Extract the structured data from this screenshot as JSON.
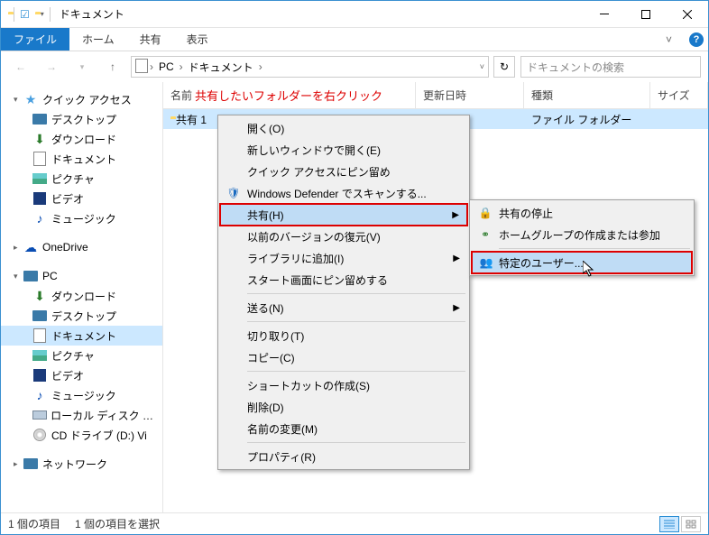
{
  "title": "ドキュメント",
  "ribbon": {
    "file": "ファイル",
    "home": "ホーム",
    "share": "共有",
    "view": "表示"
  },
  "breadcrumb": {
    "pc": "PC",
    "docs": "ドキュメント"
  },
  "search_placeholder": "ドキュメントの検索",
  "annotation": "共有したいフォルダーを右クリック",
  "columns": {
    "name": "名前",
    "date": "更新日時",
    "type": "種類",
    "size": "サイズ"
  },
  "row": {
    "name": "共有 1",
    "type": "ファイル フォルダー"
  },
  "sidebar": {
    "quick": "クイック アクセス",
    "desktop": "デスクトップ",
    "downloads": "ダウンロード",
    "documents": "ドキュメント",
    "pictures": "ピクチャ",
    "videos": "ビデオ",
    "music": "ミュージック",
    "onedrive": "OneDrive",
    "pc": "PC",
    "pc_downloads": "ダウンロード",
    "pc_desktop": "デスクトップ",
    "pc_documents": "ドキュメント",
    "pc_pictures": "ピクチャ",
    "pc_videos": "ビデオ",
    "pc_music": "ミュージック",
    "pc_cdrive": "ローカル ディスク (C:)",
    "pc_ddrive": "CD ドライブ (D:) Vi",
    "network": "ネットワーク"
  },
  "ctx": {
    "open": "開く(O)",
    "open_new": "新しいウィンドウで開く(E)",
    "pin_quick": "クイック アクセスにピン留め",
    "defender": "Windows Defender でスキャンする...",
    "share": "共有(H)",
    "restore": "以前のバージョンの復元(V)",
    "library": "ライブラリに追加(I)",
    "pin_start": "スタート画面にピン留めする",
    "send": "送る(N)",
    "cut": "切り取り(T)",
    "copy": "コピー(C)",
    "shortcut": "ショートカットの作成(S)",
    "delete": "削除(D)",
    "rename": "名前の変更(M)",
    "properties": "プロパティ(R)"
  },
  "submenu": {
    "stop": "共有の停止",
    "homegroup": "ホームグループの作成または参加",
    "specific": "特定のユーザー..."
  },
  "status": {
    "count": "1 個の項目",
    "selected": "1 個の項目を選択"
  }
}
